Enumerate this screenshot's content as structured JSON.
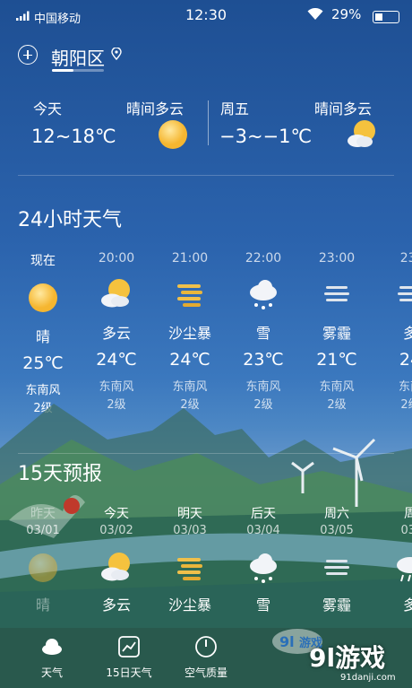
{
  "status_bar": {
    "carrier": "中国移动",
    "time": "12:30",
    "battery": "29%"
  },
  "location": {
    "city": "朝阳区"
  },
  "today": {
    "label": "今天",
    "temp": "12~18℃",
    "condition": "晴间多云"
  },
  "friday": {
    "label": "周五",
    "temp": "−3~−1℃",
    "condition": "晴间多云"
  },
  "hourly": {
    "title": "24小时天气",
    "items": [
      {
        "time": "现在",
        "icon": "sun-icon",
        "cond": "晴",
        "temp": "25℃",
        "wind": "东南风",
        "level": "2级"
      },
      {
        "time": "20:00",
        "icon": "partly-cloudy-icon",
        "cond": "多云",
        "temp": "24℃",
        "wind": "东南风",
        "level": "2级"
      },
      {
        "time": "21:00",
        "icon": "sandstorm-icon",
        "cond": "沙尘暴",
        "temp": "24℃",
        "wind": "东南风",
        "level": "2级"
      },
      {
        "time": "22:00",
        "icon": "snow-icon",
        "cond": "雪",
        "temp": "23℃",
        "wind": "东南风",
        "level": "2级"
      },
      {
        "time": "23:00",
        "icon": "haze-icon",
        "cond": "雾霾",
        "temp": "21℃",
        "wind": "东南风",
        "level": "2级"
      },
      {
        "time": "23:",
        "icon": "haze-icon",
        "cond": "多",
        "temp": "24",
        "wind": "东南",
        "level": "2级"
      }
    ]
  },
  "forecast": {
    "title": "15天预报",
    "items": [
      {
        "day": "昨天",
        "date": "03/01",
        "icon": "sun-icon",
        "cond": "晴"
      },
      {
        "day": "今天",
        "date": "03/02",
        "icon": "partly-cloudy-icon",
        "cond": "多云"
      },
      {
        "day": "明天",
        "date": "03/03",
        "icon": "sandstorm-icon",
        "cond": "沙尘暴"
      },
      {
        "day": "后天",
        "date": "03/04",
        "icon": "snow-icon",
        "cond": "雪"
      },
      {
        "day": "周六",
        "date": "03/05",
        "icon": "haze-icon",
        "cond": "雾霾"
      },
      {
        "day": "周",
        "date": "03/",
        "icon": "rain-icon",
        "cond": "多"
      }
    ]
  },
  "nav": {
    "items": [
      {
        "label": "天气",
        "icon": "cloud-icon"
      },
      {
        "label": "15日天气",
        "icon": "chart-icon"
      },
      {
        "label": "空气质量",
        "icon": "gauge-icon"
      }
    ]
  },
  "watermark": {
    "text": "9l游戏",
    "url": "91danji.com",
    "badge": "游戏"
  }
}
